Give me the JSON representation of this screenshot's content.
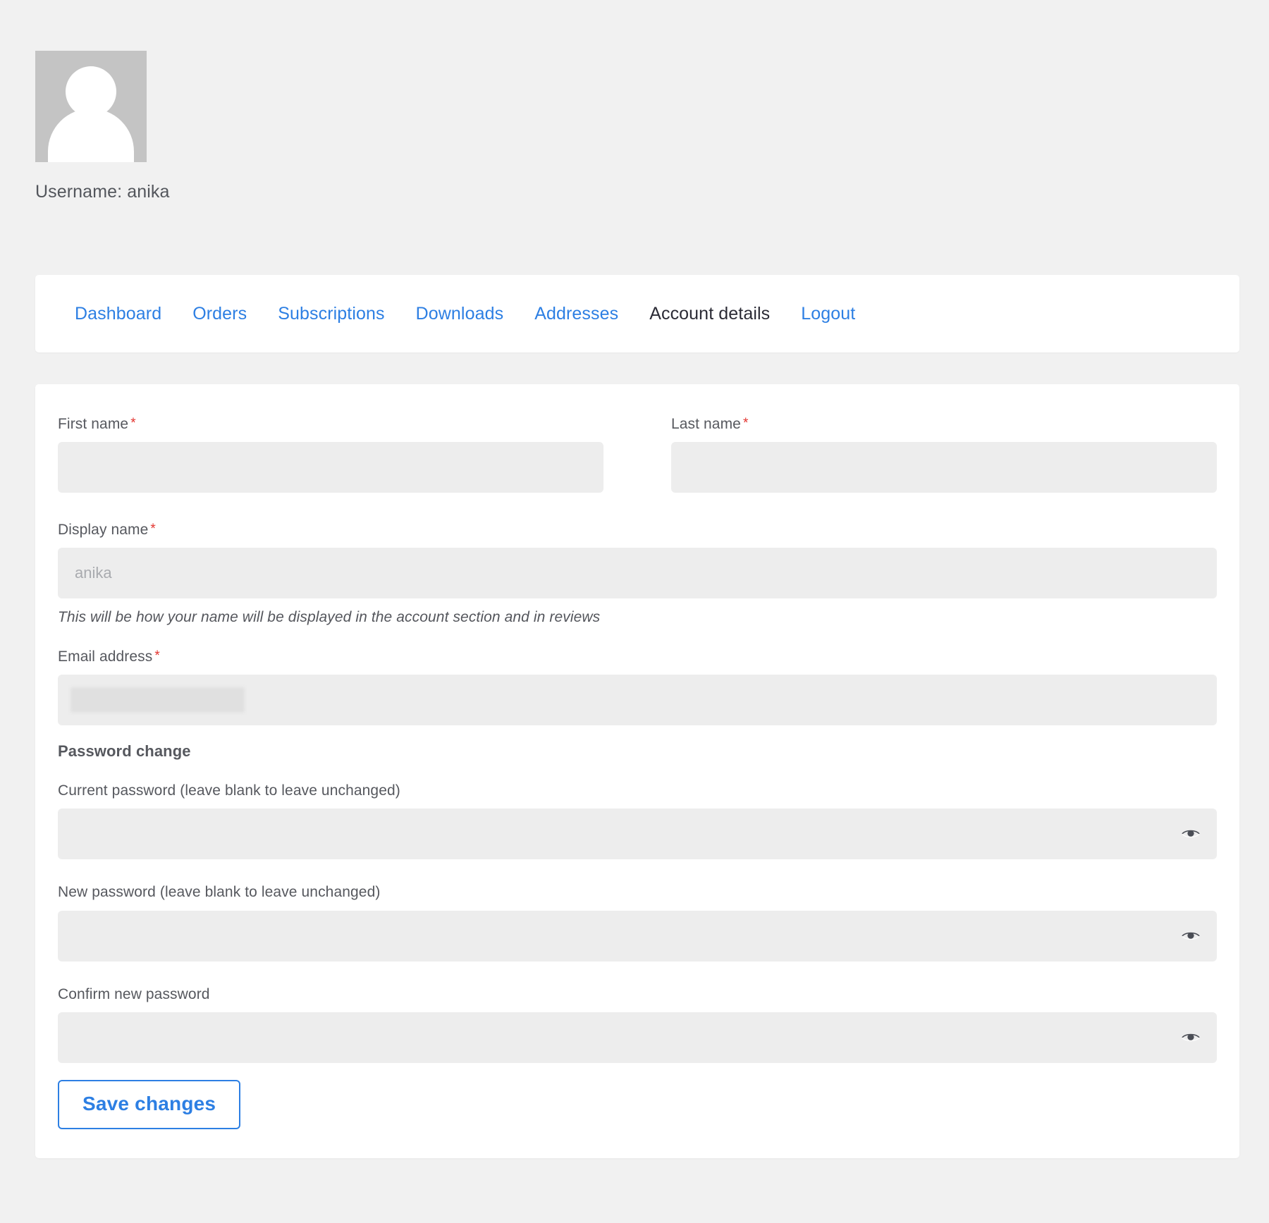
{
  "account": {
    "avatar_icon": "user-avatar-placeholder-icon",
    "username_line": "Username: anika"
  },
  "nav": {
    "items": [
      {
        "label": "Dashboard",
        "active": false
      },
      {
        "label": "Orders",
        "active": false
      },
      {
        "label": "Subscriptions",
        "active": false
      },
      {
        "label": "Downloads",
        "active": false
      },
      {
        "label": "Addresses",
        "active": false
      },
      {
        "label": "Account details",
        "active": true
      },
      {
        "label": "Logout",
        "active": false
      }
    ]
  },
  "form": {
    "first_name": {
      "label": "First name",
      "required_marker": "*",
      "value": "",
      "placeholder": ""
    },
    "last_name": {
      "label": "Last name",
      "required_marker": "*",
      "value": "",
      "placeholder": ""
    },
    "display_name": {
      "label": "Display name",
      "required_marker": "*",
      "value": "",
      "placeholder": "anika",
      "helper": "This will be how your name will be displayed in the account section and in reviews"
    },
    "email": {
      "label": "Email address",
      "required_marker": "*",
      "value": "",
      "placeholder": "",
      "redacted": true
    },
    "password_section_title": "Password change",
    "current_password": {
      "label": "Current password (leave blank to leave unchanged)",
      "value": "",
      "placeholder": "",
      "toggle_icon": "eye-icon"
    },
    "new_password": {
      "label": "New password (leave blank to leave unchanged)",
      "value": "",
      "placeholder": "",
      "toggle_icon": "eye-icon"
    },
    "confirm_password": {
      "label": "Confirm new password",
      "value": "",
      "placeholder": "",
      "toggle_icon": "eye-icon"
    },
    "save_label": "Save changes"
  },
  "colors": {
    "link_blue": "#2d7fe3",
    "active_tab": "#2b2b35",
    "required_red": "#e3342f",
    "page_background": "#f1f1f1",
    "card_background": "#ffffff",
    "input_background": "#ededed",
    "avatar_background": "#c4c4c4"
  }
}
